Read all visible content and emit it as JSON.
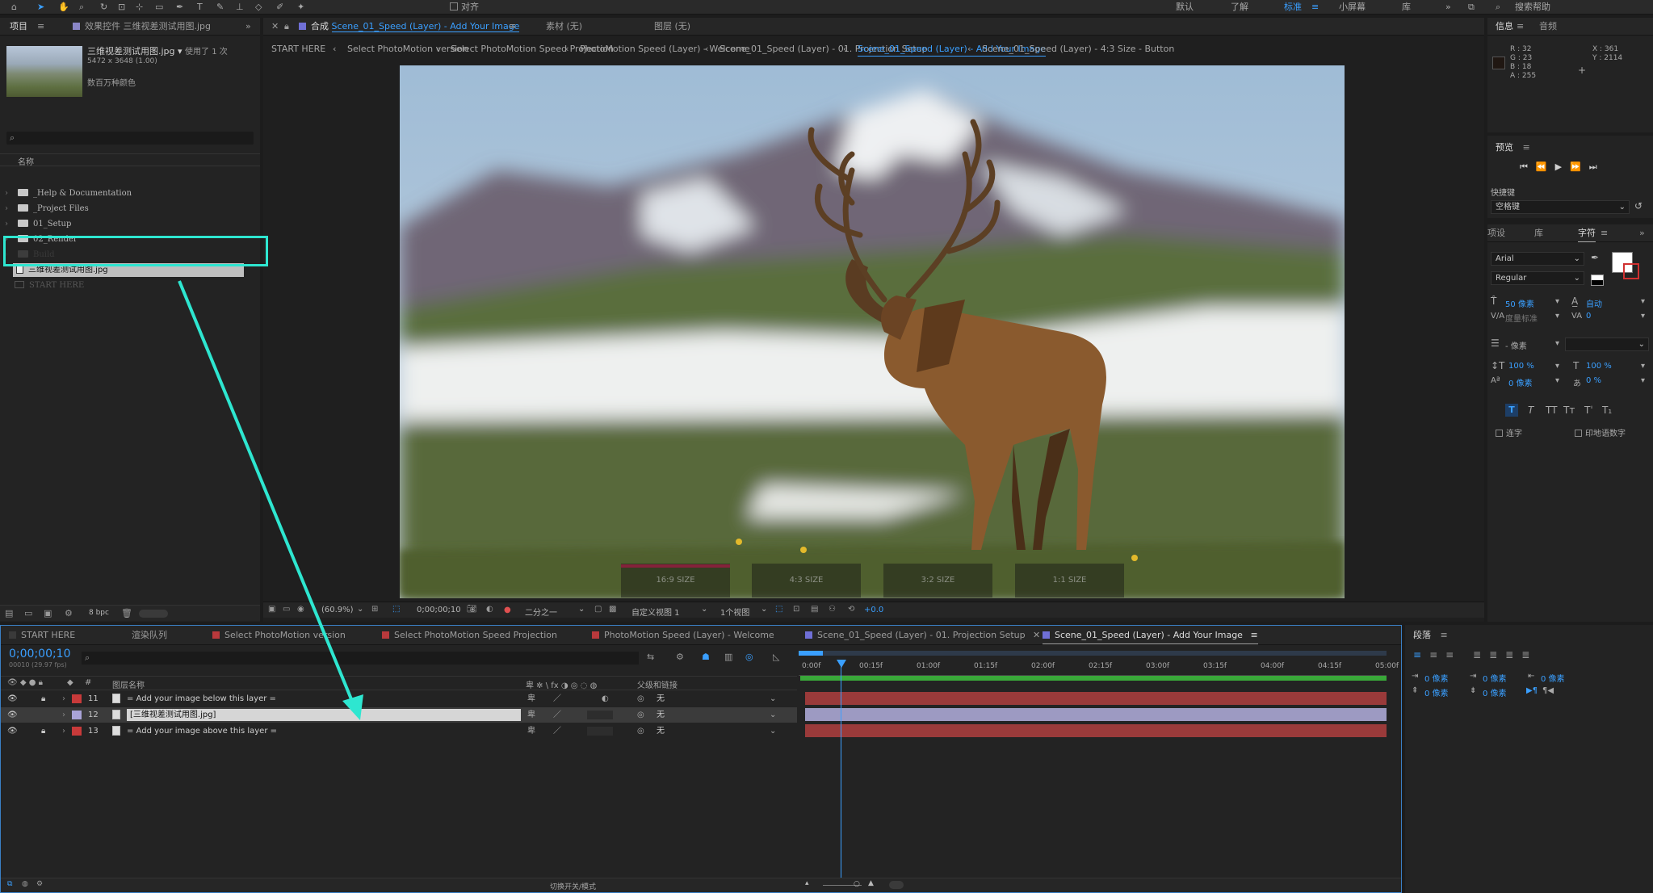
{
  "toolbar": {
    "workspaces": [
      "默认",
      "了解",
      "标准",
      "小屏幕",
      "库"
    ],
    "active_workspace": "标准",
    "search_placeholder": "搜索帮助",
    "snap_label": "对齐"
  },
  "project_panel": {
    "tab_project": "项目",
    "tab_effects": "效果控件 三维视差测试用图.jpg",
    "file_name": "三维视差测试用图.jpg ▾",
    "usage": "使用了 1 次",
    "dimensions": "5472 x 3648 (1.00)",
    "colors": "数百万种颜色",
    "column_name": "名称",
    "items": [
      {
        "type": "folder",
        "label": "_Help & Documentation"
      },
      {
        "type": "folder",
        "label": "_Project Files"
      },
      {
        "type": "folder",
        "label": "01_Setup"
      },
      {
        "type": "folder",
        "label": "02_Render"
      },
      {
        "type": "folder",
        "label": "Build"
      },
      {
        "type": "file",
        "label": "三维视差测试用图.jpg",
        "selected": true
      },
      {
        "type": "comp",
        "label": "START HERE"
      }
    ],
    "bpc": "8 bpc"
  },
  "viewer": {
    "tab_comp_prefix": "合成",
    "tab_comp_name": "Scene_01_Speed (Layer) - Add Your Image",
    "tab_footage": "素材  (无)",
    "tab_layer": "图层  (无)",
    "breadcrumbs": [
      "START HERE",
      "Select PhotoMotion version",
      "Select PhotoMotion Speed Projection",
      "PhotoMotion Speed (Layer) - Welcome",
      "Scene_01_Speed (Layer) - 01. Projection Setup",
      "Scene_01_Speed (Layer) - Add Your Image",
      "Scene_01_Speed (Layer) - 4:3 Size - Button"
    ],
    "active_breadcrumb": 5,
    "size_buttons": [
      "16:9 SIZE",
      "4:3 SIZE",
      "3:2 SIZE",
      "1:1 SIZE"
    ],
    "zoom": "(60.9%)",
    "timecode": "0;00;00;10",
    "resolution": "二分之一",
    "view": "自定义视图 1",
    "views_count": "1个视图",
    "exposure": "+0.0"
  },
  "info_panel": {
    "tab_info": "信息",
    "tab_audio": "音频",
    "r": "R : 32",
    "g": "G : 23",
    "b": "B : 18",
    "a": "A : 255",
    "x": "X : 361",
    "y": "Y : 2114",
    "swatch_color": "#201712"
  },
  "preview_panel": {
    "title": "预览",
    "shortcut_label": "快捷键",
    "shortcut_value": "空格键"
  },
  "character_panel": {
    "tabs": [
      "项设",
      "库",
      "字符"
    ],
    "font": "Arial",
    "style": "Regular",
    "font_size": "50 像素",
    "leading": "自动",
    "kerning": "度量标准",
    "tracking": "0",
    "stroke": "- 像素",
    "vscale": "100 %",
    "hscale": "100 %",
    "baseline": "0 像素",
    "tsume": "0 %",
    "ligature": "连字",
    "hindi": "印地语数字"
  },
  "paragraph_panel": {
    "title": "段落",
    "indent1": "0 像素",
    "indent2": "0 像素",
    "indent3": "0 像素",
    "space1": "0 像素",
    "space2": "0 像素"
  },
  "timeline": {
    "tabs": [
      {
        "label": "START HERE",
        "color": "#3a3a3a"
      },
      {
        "label": "渲染队列",
        "color": ""
      },
      {
        "label": "Select PhotoMotion version",
        "color": "#b8393c"
      },
      {
        "label": "Select PhotoMotion Speed Projection",
        "color": "#b8393c"
      },
      {
        "label": "PhotoMotion Speed (Layer) - Welcome",
        "color": "#b8393c"
      },
      {
        "label": "Scene_01_Speed (Layer) - 01. Projection Setup",
        "color": "#6f6fd6"
      },
      {
        "label": "Scene_01_Speed (Layer) - Add Your Image",
        "color": "#6f6fd6"
      }
    ],
    "timecode": "0;00;00;10",
    "timecode_sub": "00010 (29.97 fps)",
    "col_layer_name": "图层名称",
    "col_parent": "父级和链接",
    "layers": [
      {
        "num": "11",
        "name": "= Add your image below this layer =",
        "parent": "无",
        "color": "#c83a3a"
      },
      {
        "num": "12",
        "name": "[三维视差测试用图.jpg]",
        "parent": "无",
        "color": "#a9a3d8"
      },
      {
        "num": "13",
        "name": "= Add your image above this layer =",
        "parent": "无",
        "color": "#c83a3a"
      }
    ],
    "ruler": [
      "0:00f",
      "00:15f",
      "01:00f",
      "01:15f",
      "02:00f",
      "02:15f",
      "03:00f",
      "03:15f",
      "04:00f",
      "04:15f",
      "05:00f"
    ],
    "footer_toggle": "切换开关/模式"
  }
}
